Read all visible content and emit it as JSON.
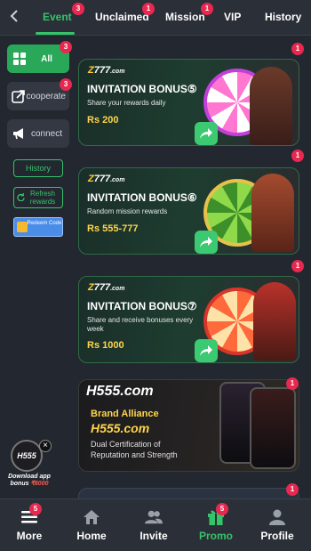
{
  "tabs": [
    {
      "label": "Event",
      "badge": "3",
      "active": true
    },
    {
      "label": "Unclaimed",
      "badge": "1"
    },
    {
      "label": "Mission",
      "badge": "1"
    },
    {
      "label": "VIP"
    },
    {
      "label": "History"
    }
  ],
  "sidebar": {
    "all": {
      "label": "All",
      "badge": "3"
    },
    "cooperate": {
      "label": "cooperate",
      "badge": "3"
    },
    "connect": {
      "label": "connect"
    },
    "history": "History",
    "refresh": "Refresh rewards",
    "redeem": "Redeem Code"
  },
  "banners": [
    {
      "logo_a": "Z",
      "logo_b": "777",
      "logo_c": ".com",
      "title": "INVITATION BONUS⑤",
      "sub": "Share your rewards daily",
      "amount": "Rs 200",
      "badge": "1"
    },
    {
      "logo_a": "Z",
      "logo_b": "777",
      "logo_c": ".com",
      "title": "INVITATION BONUS⑥",
      "sub": "Random mission rewards",
      "amount": "Rs 555-777",
      "badge": "1"
    },
    {
      "logo_a": "Z",
      "logo_b": "777",
      "logo_c": ".com",
      "title": "INVITATION BONUS⑦",
      "sub": "Share and receive bonuses every week",
      "amount": "Rs 1000",
      "badge": "1"
    }
  ],
  "brand": {
    "logo": "H555.com",
    "heading": "Brand Alliance",
    "logo2": "H555.com",
    "desc": "Dual Certification of Reputation and Strength",
    "badge": "1"
  },
  "partial_badge": "1",
  "float": {
    "logo": "H555",
    "line1": "Download app",
    "line2": "bonus",
    "amount": "₹8000"
  },
  "nav": [
    {
      "label": "More",
      "icon": "menu-icon",
      "badge": "5"
    },
    {
      "label": "Home",
      "icon": "home-icon"
    },
    {
      "label": "Invite",
      "icon": "users-icon"
    },
    {
      "label": "Promo",
      "icon": "gift-icon",
      "badge": "5",
      "active": true
    },
    {
      "label": "Profile",
      "icon": "user-icon"
    }
  ],
  "colors": {
    "accent": "#35c46a",
    "badge": "#e8284f",
    "background": "#23272f"
  }
}
